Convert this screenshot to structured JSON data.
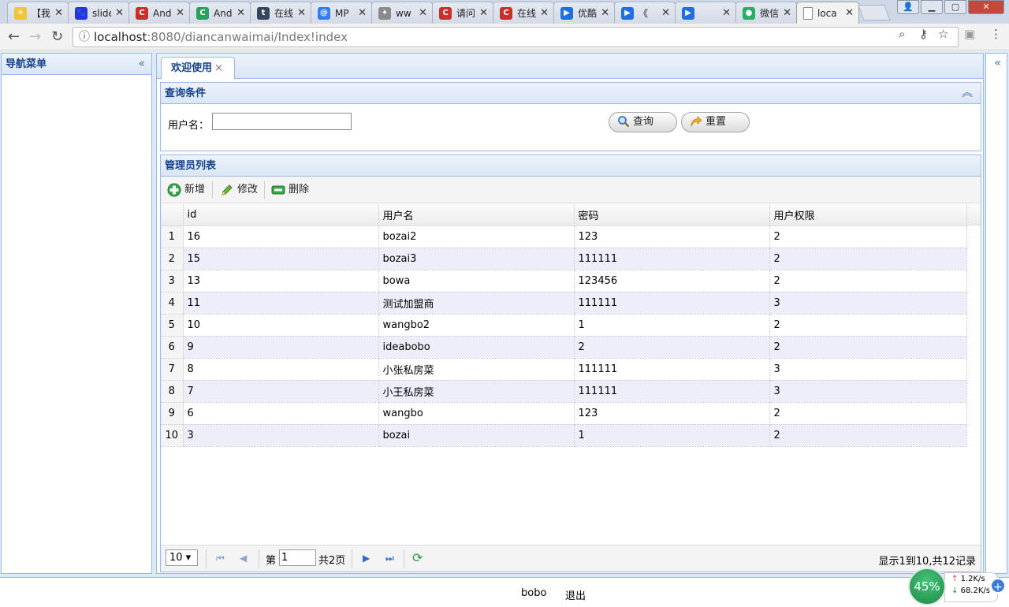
{
  "browser": {
    "tabs": [
      {
        "title": "【我",
        "icon": "sun-favicon",
        "color": "#f3c431",
        "glyph": "☀"
      },
      {
        "title": "slide",
        "icon": "baidu-favicon",
        "color": "#2932e1",
        "glyph": "🐾"
      },
      {
        "title": "Andr",
        "icon": "csdn-favicon",
        "color": "#c9302c",
        "glyph": "C"
      },
      {
        "title": "Andr",
        "icon": "green-c-favicon",
        "color": "#2b9f5b",
        "glyph": "C"
      },
      {
        "title": "在线",
        "icon": "tumblr-favicon",
        "color": "#35465c",
        "glyph": "t"
      },
      {
        "title": "MP",
        "icon": "mp-favicon",
        "color": "#2f80ed",
        "glyph": "@"
      },
      {
        "title": "ww",
        "icon": "puzzle-favicon",
        "color": "#8a8a8a",
        "glyph": "✦"
      },
      {
        "title": "请问",
        "icon": "csdn-favicon",
        "color": "#c9302c",
        "glyph": "C"
      },
      {
        "title": "在线",
        "icon": "csdn-favicon",
        "color": "#c9302c",
        "glyph": "C"
      },
      {
        "title": "优酷",
        "icon": "youku-favicon",
        "color": "#1f6fe0",
        "glyph": "▶"
      },
      {
        "title": "《",
        "icon": "youku-favicon",
        "color": "#1f6fe0",
        "glyph": "▶"
      },
      {
        "title": "",
        "icon": "youku-favicon",
        "color": "#1f6fe0",
        "glyph": "▶"
      },
      {
        "title": "微信",
        "icon": "wechat-favicon",
        "color": "#2aae67",
        "glyph": "●"
      },
      {
        "title": "loca",
        "icon": "page-favicon",
        "color": "#ffffff",
        "glyph": "",
        "active": true
      }
    ],
    "url_host": "localhost",
    "url_rest": ":8080/diancanwaimai/Index!index"
  },
  "nav": {
    "title": "导航菜单"
  },
  "content": {
    "tab_label": "欢迎使用",
    "query": {
      "title": "查询条件",
      "username_label": "用户名：",
      "username_value": "",
      "search_label": "查询",
      "reset_label": "重置"
    },
    "list": {
      "title": "管理员列表",
      "toolbar": {
        "add": "新增",
        "edit": "修改",
        "delete": "删除"
      },
      "columns": [
        "id",
        "用户名",
        "密码",
        "用户权限"
      ],
      "rows": [
        {
          "n": "1",
          "id": "16",
          "name": "bozai2",
          "password": "123",
          "role": "2"
        },
        {
          "n": "2",
          "id": "15",
          "name": "bozai3",
          "password": "111111",
          "role": "2"
        },
        {
          "n": "3",
          "id": "13",
          "name": "bowa",
          "password": "123456",
          "role": "2"
        },
        {
          "n": "4",
          "id": "11",
          "name": "测试加盟商",
          "password": "111111",
          "role": "3"
        },
        {
          "n": "5",
          "id": "10",
          "name": "wangbo2",
          "password": "1",
          "role": "2"
        },
        {
          "n": "6",
          "id": "9",
          "name": "ideabobo",
          "password": "2",
          "role": "2"
        },
        {
          "n": "7",
          "id": "8",
          "name": "小张私房菜",
          "password": "111111",
          "role": "3"
        },
        {
          "n": "8",
          "id": "7",
          "name": "小王私房菜",
          "password": "111111",
          "role": "3"
        },
        {
          "n": "9",
          "id": "6",
          "name": "wangbo",
          "password": "123",
          "role": "2"
        },
        {
          "n": "10",
          "id": "3",
          "name": "bozai",
          "password": "1",
          "role": "2"
        }
      ],
      "pager": {
        "page_size": "10",
        "page_prefix": "第",
        "current_page": "1",
        "total_pages": "共2页",
        "display": "显示1到10,共12记录"
      }
    }
  },
  "footer": {
    "user": "bobo",
    "logout": "退出"
  },
  "speed_widget": {
    "percent": "45%",
    "up": "1.2K/s",
    "down": "68.2K/s"
  },
  "colors": {
    "accent": "#15428b",
    "border": "#99bbe8",
    "alt_row": "#eeeefb"
  }
}
